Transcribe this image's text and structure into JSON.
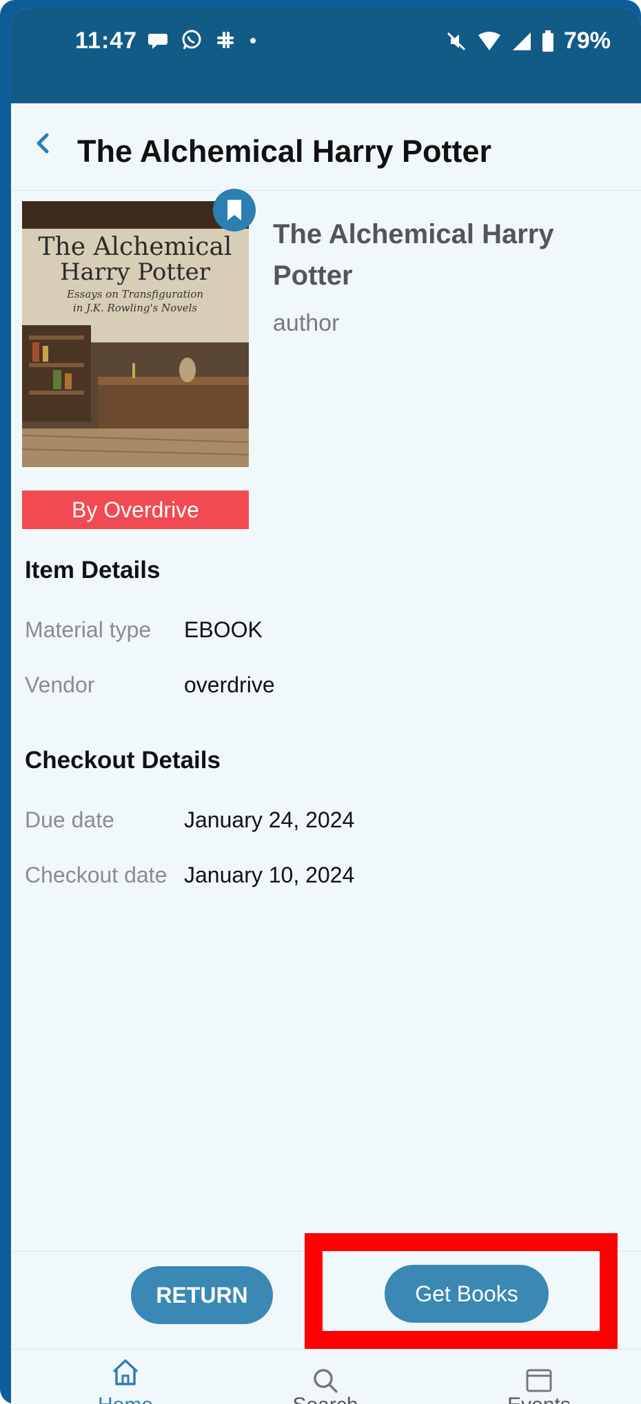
{
  "status_bar": {
    "time": "11:47",
    "battery": "79%",
    "left_icons": [
      "chat-bubble-icon",
      "whatsapp-icon",
      "slack-icon",
      "dot-icon"
    ],
    "right_icons": [
      "mute-icon",
      "wifi-icon",
      "signal-icon",
      "battery-icon"
    ]
  },
  "header": {
    "title": "The Alchemical Harry Potter"
  },
  "cover": {
    "line1": "The Alchemical",
    "line2": "Harry Potter",
    "line3": "Essays on Transfiguration",
    "line4": "in J.K. Rowling's Novels",
    "band": "By Overdrive"
  },
  "book": {
    "title": "The Alchemical Harry Potter",
    "author": "author"
  },
  "item_details": {
    "heading": "Item Details",
    "rows": [
      {
        "label": "Material type",
        "value": "EBOOK"
      },
      {
        "label": "Vendor",
        "value": "overdrive"
      }
    ]
  },
  "checkout_details": {
    "heading": "Checkout Details",
    "rows": [
      {
        "label": "Due date",
        "value": "January 24, 2024"
      },
      {
        "label": "Checkout date",
        "value": "January 10, 2024"
      }
    ]
  },
  "actions": {
    "return_label": "RETURN",
    "get_books_label": "Get Books"
  },
  "tabs": [
    {
      "label": "Home",
      "icon": "home-icon"
    },
    {
      "label": "Search",
      "icon": "search-icon"
    },
    {
      "label": "Events",
      "icon": "events-icon"
    }
  ],
  "colors": {
    "accent": "#3a88b3",
    "status_bar": "#135b87",
    "band": "#f24a52",
    "highlight": "#ff0000"
  }
}
